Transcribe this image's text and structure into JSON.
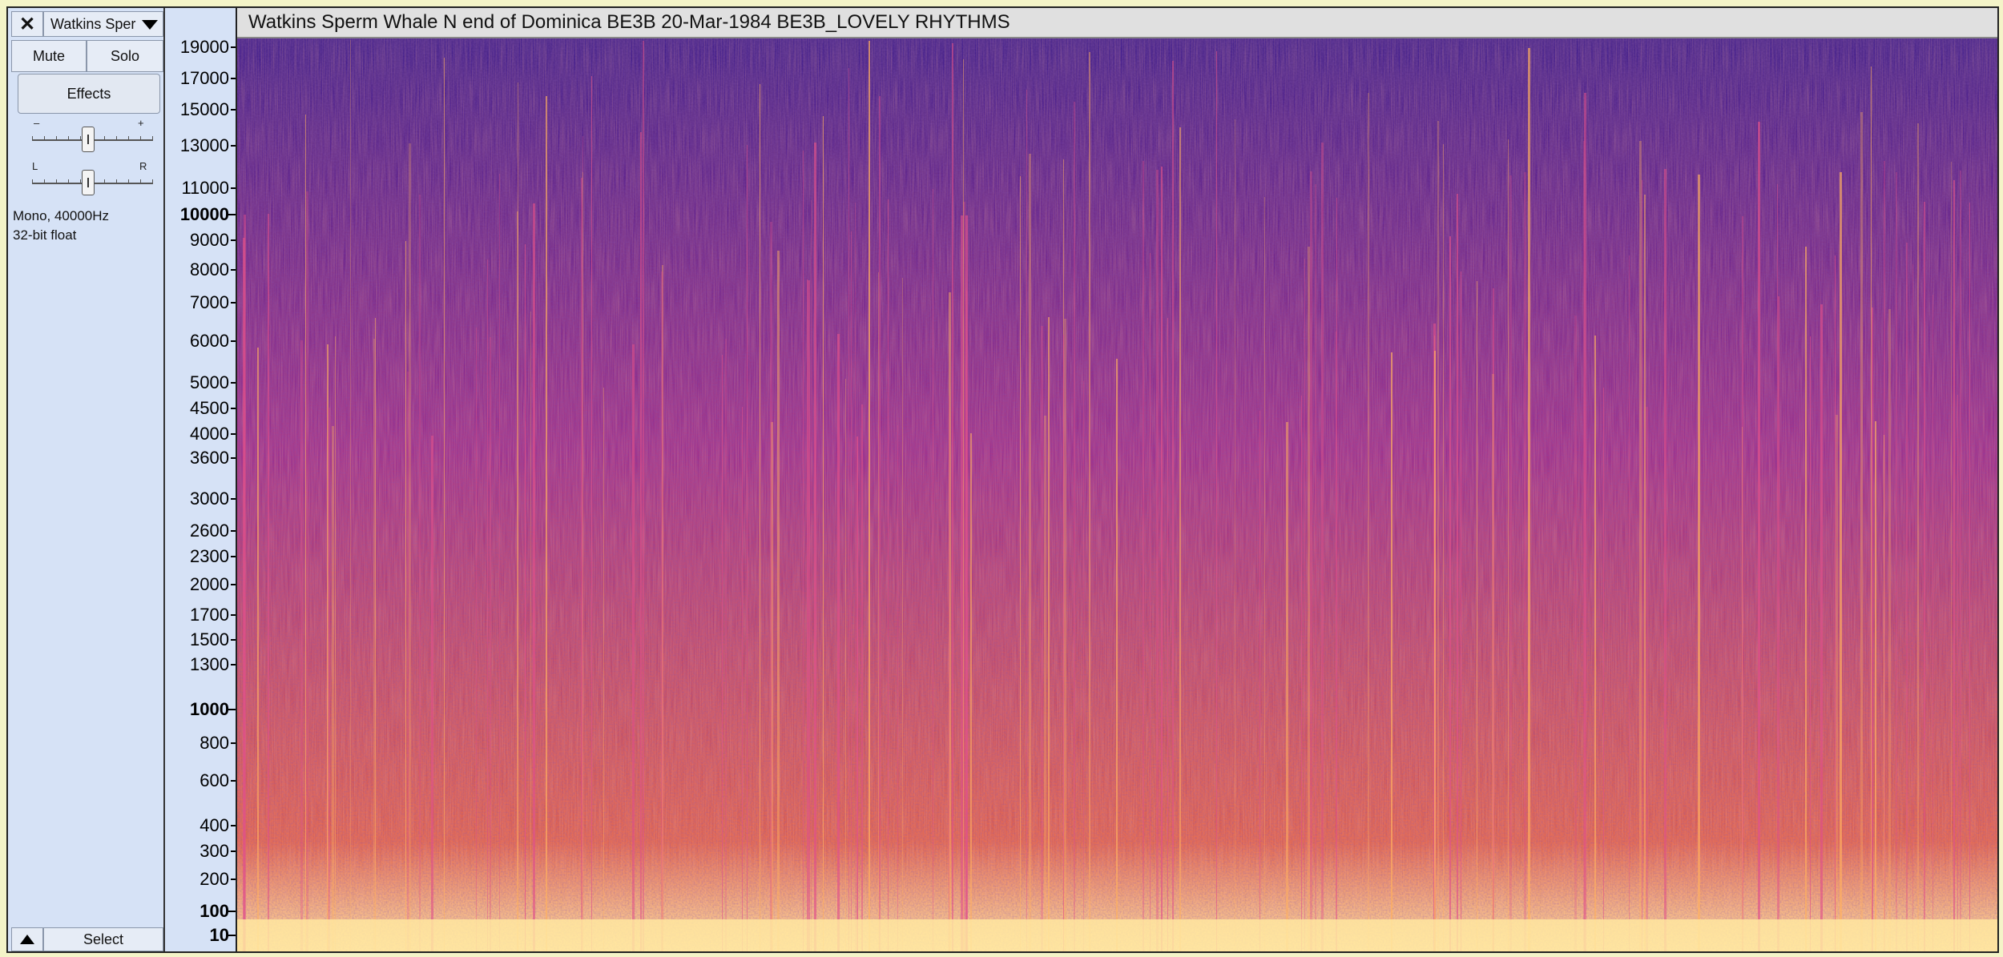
{
  "track": {
    "close_label": "✕",
    "name": "Watkins Sper",
    "mute_label": "Mute",
    "solo_label": "Solo",
    "effects_label": "Effects",
    "gain_minus": "–",
    "gain_plus": "+",
    "pan_left": "L",
    "pan_right": "R",
    "format_line1": "Mono, 40000Hz",
    "format_line2": "32-bit float",
    "select_label": "Select",
    "title": "Watkins Sperm Whale N end of Dominica BE3B 20-Mar-1984 BE3B_LOVELY RHYTHMS"
  },
  "ruler_labels": [
    "19000",
    "17000",
    "15000",
    "13000",
    "11000",
    "10000",
    "9000",
    "8000",
    "7000",
    "6000",
    "5000",
    "4500",
    "4000",
    "3600",
    "3000",
    "2600",
    "2300",
    "2000",
    "1700",
    "1500",
    "1300",
    "1000",
    "800",
    "600",
    "400",
    "300",
    "200",
    "100",
    "10"
  ],
  "colors": {
    "spectro_base": "#5a1f8c",
    "spectro_top": "#3a1a8a",
    "spectro_mid": "#9a2a8a",
    "spectro_low": "#e0604a",
    "spectro_floor": "#ffe6a0"
  },
  "icons": {
    "close": "close-icon",
    "dropdown": "chevron-down-icon",
    "collapse": "triangle-up-icon"
  }
}
